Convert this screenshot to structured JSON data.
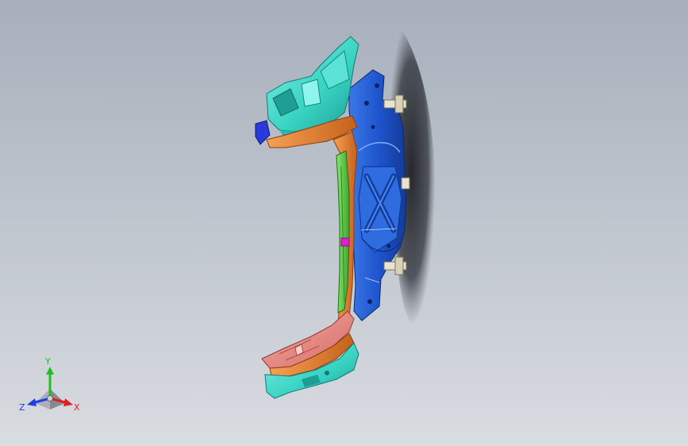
{
  "viewport": {
    "background_top": "#a6afbb",
    "background_bottom": "#d9dce1"
  },
  "model": {
    "colors": {
      "blue_panel": "#2255cc",
      "blue_panel_dark": "#163c9a",
      "cyan_part": "#3fd8c8",
      "orange_rail": "#e07a2a",
      "green_member": "#55cc44",
      "pink_part": "#e88a84",
      "magenta_clip": "#e020d0",
      "shadow": "#2a2d33"
    }
  },
  "triad": {
    "x_label": "X",
    "y_label": "Y",
    "z_label": "Z",
    "x_color": "#e02020",
    "y_color": "#20c020",
    "z_color": "#2040e0"
  }
}
